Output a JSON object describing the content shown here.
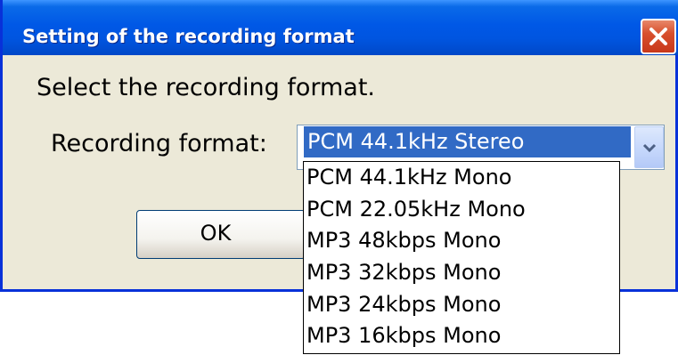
{
  "window": {
    "title": "Setting of the recording format",
    "close_icon": "close-icon"
  },
  "dialog": {
    "prompt": "Select the recording format.",
    "format_label": "Recording format:",
    "ok_label": "OK"
  },
  "combo": {
    "selected": "PCM 44.1kHz Stereo",
    "arrow_icon": "chevron-down-icon",
    "options": [
      "PCM 44.1kHz Mono",
      "PCM 22.05kHz Mono",
      "MP3 48kbps Mono",
      "MP3 32kbps Mono",
      "MP3 24kbps Mono",
      "MP3 16kbps Mono"
    ]
  },
  "colors": {
    "titlebar": "#0055e0",
    "selection": "#316ac5",
    "dialog_bg": "#ece9d8",
    "close_button": "#d8502e"
  }
}
